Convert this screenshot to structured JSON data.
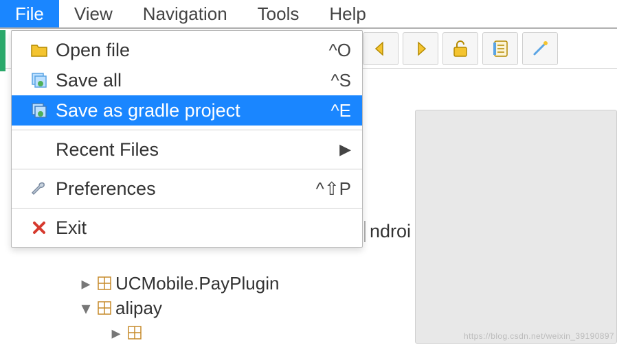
{
  "menubar": {
    "file": "File",
    "view": "View",
    "navigation": "Navigation",
    "tools": "Tools",
    "help": "Help"
  },
  "filemenu": {
    "open": {
      "label": "Open file",
      "shortcut": "^O"
    },
    "saveall": {
      "label": "Save all",
      "shortcut": "^S"
    },
    "savegradle": {
      "label": "Save as gradle project",
      "shortcut": "^E"
    },
    "recent": {
      "label": "Recent Files",
      "arrow": "▶"
    },
    "prefs": {
      "label": "Preferences",
      "shortcut": "^⇧P"
    },
    "exit": {
      "label": "Exit"
    }
  },
  "tree": {
    "ucmobile": "UCMobile.PayPlugin",
    "alipay": "alipay"
  },
  "side_label": "ndroi",
  "watermark": "https://blog.csdn.net/weixin_39190897"
}
